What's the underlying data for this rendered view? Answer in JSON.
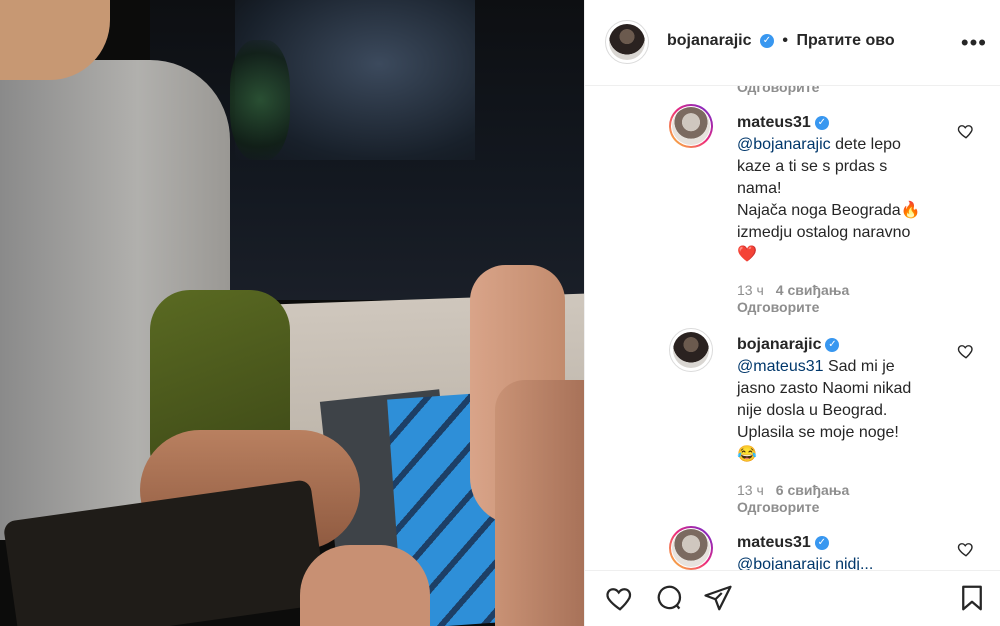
{
  "header": {
    "username": "bojanarajic",
    "follow_label": "Пратите ово",
    "more_icon": "more-options-icon"
  },
  "comments": [
    {
      "reply_top_label": "Одговорите"
    },
    {
      "username": "mateus31",
      "lines": [
        {
          "mention": "@bojanarajic",
          "text": " dete lepo"
        },
        {
          "text": "kaze a ti se s prdas s"
        },
        {
          "text": "nama!"
        },
        {
          "text": "Najača noga Beograda🔥"
        },
        {
          "text": "izmedju ostalog naravno"
        },
        {
          "text": "❤️"
        }
      ],
      "time": "13 ч",
      "likes": "4 свиђања",
      "reply_label": "Одговорите"
    },
    {
      "username": "bojanarajic",
      "lines": [
        {
          "mention": "@mateus31",
          "text": " Sad mi je"
        },
        {
          "text": "jasno zasto Naomi nikad"
        },
        {
          "text": "nije dosla u Beograd."
        },
        {
          "text": "Uplasila se moje noge!"
        },
        {
          "text": "😂"
        }
      ],
      "time": "13 ч",
      "likes": "6 свиђања",
      "reply_label": "Одговорите"
    },
    {
      "username": "mateus31",
      "partial_text": "@bojanarajic nidj..."
    }
  ],
  "colors": {
    "verified": "#3897f0",
    "mention": "#00376b",
    "meta": "#8e8e8e"
  }
}
